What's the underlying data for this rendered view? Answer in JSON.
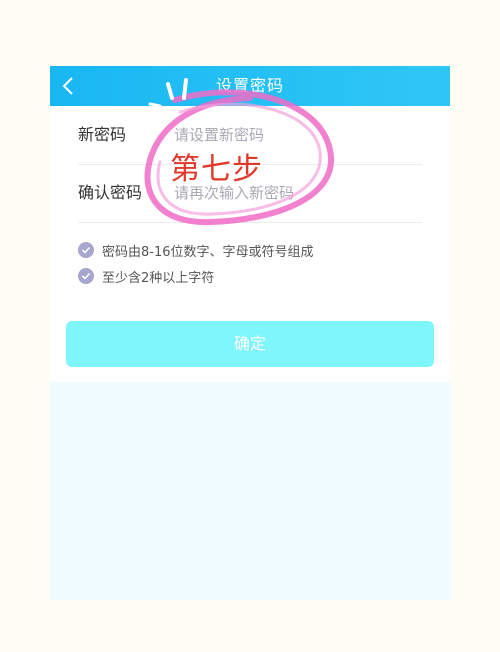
{
  "header": {
    "title": "设置密码",
    "back_icon": "chevron-left-icon"
  },
  "form": {
    "new_password": {
      "label": "新密码",
      "placeholder": "请设置新密码",
      "value": ""
    },
    "confirm_password": {
      "label": "确认密码",
      "placeholder": "请再次输入新密码",
      "value": ""
    }
  },
  "rules": [
    {
      "text": "密码由8-16位数字、字母或符号组成",
      "icon": "check-circle-icon"
    },
    {
      "text": "至少含2种以上字符",
      "icon": "check-circle-icon"
    }
  ],
  "confirm_button": {
    "label": "确定"
  },
  "annotation": {
    "text": "第七步",
    "color": "#e2382b",
    "circle_color": "#f06cc8"
  },
  "colors": {
    "header_bg": "#19b7f2",
    "button_bg": "#7ff6fb",
    "check_icon": "#a6a6ce",
    "placeholder": "#a9a9b5",
    "lower_panel": "#f0fbff"
  }
}
